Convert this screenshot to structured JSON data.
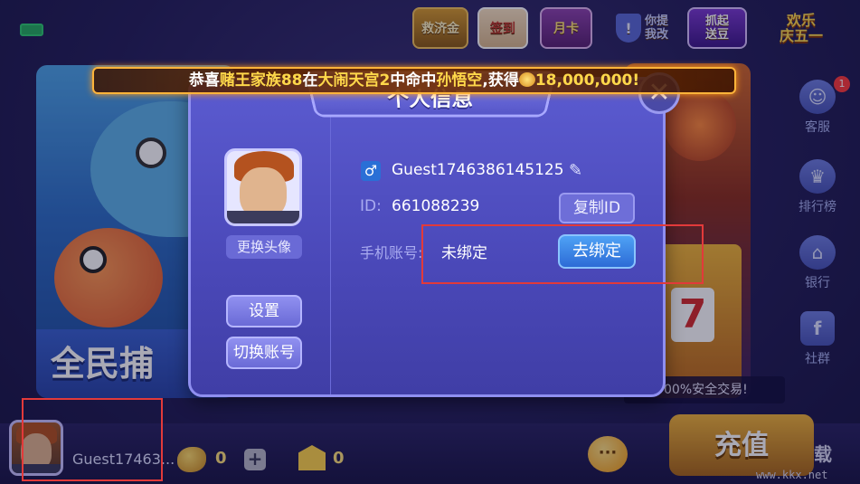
{
  "top_bar": {
    "relief_label": "救济金",
    "sign_label": "签到",
    "month_card_label": "月卡",
    "security_label_1": "你提",
    "security_label_2": "我改",
    "catch_label_1": "抓起",
    "catch_label_2": "送豆",
    "happy_label_1": "欢乐",
    "happy_label_2": "庆五一"
  },
  "broadcast": {
    "prefix": "恭喜",
    "player": "赌王家族88",
    "in": "在",
    "room": "大闹天宫2",
    "hit": "中命中",
    "target": "孙悟空",
    "gain": ",获得",
    "amount": "18,000,000!"
  },
  "modal": {
    "title": "个人信息",
    "change_avatar": "更换头像",
    "settings_button": "设置",
    "switch_account_button": "切换账号",
    "gender_symbol": "♂",
    "username": "Guest1746386145125",
    "id_label": "ID:",
    "id_value": "661088239",
    "copy_id_button": "复制ID",
    "phone_label": "手机账号:",
    "phone_value": "未绑定",
    "bind_button": "去绑定",
    "close_symbol": "✕"
  },
  "side_menu": {
    "service_label": "客服",
    "service_badge": "1",
    "ranking_label": "排行榜",
    "bank_label": "银行",
    "community_label": "社群"
  },
  "background": {
    "left_banner": "全民捕",
    "right_slot": "7",
    "safe_trade": "00%安全交易!"
  },
  "bottom_bar": {
    "username_short": "Guest17463...",
    "bean_count": "0",
    "plus_label": "+",
    "bank_count": "0",
    "chat_symbol": "···",
    "recharge_label": "充值",
    "watermark": "www.kkx.net",
    "watermark_dl": "载"
  },
  "colors": {
    "highlight": "#e23a3a",
    "modal_bg": "#4a48b8",
    "bind_button": "#2d6bd6",
    "gold": "#ffd84a"
  }
}
